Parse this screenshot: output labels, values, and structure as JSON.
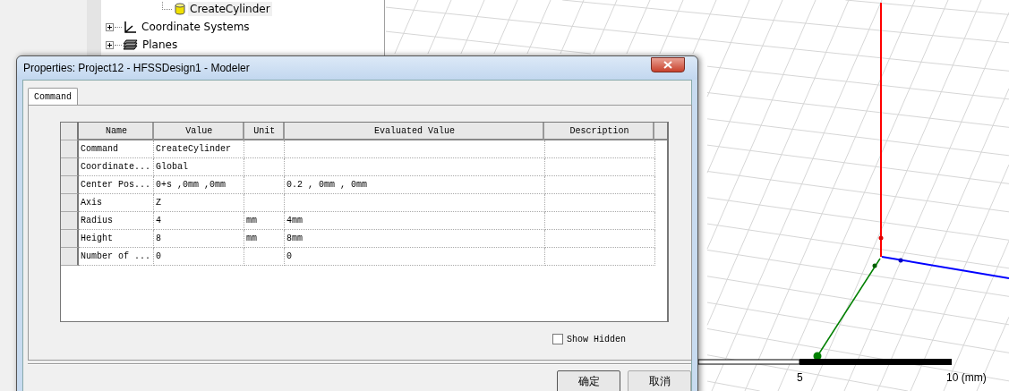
{
  "tree": {
    "items": [
      {
        "label": "CreateCylinder",
        "kind": "cylinder",
        "selected": true
      },
      {
        "label": "Coordinate Systems",
        "kind": "coordinate-systems",
        "expanded": false,
        "selected": false
      },
      {
        "label": "Planes",
        "kind": "planes",
        "expanded": false,
        "selected": false
      }
    ]
  },
  "viewport": {
    "scale_labels": [
      "5",
      "10 (mm)"
    ]
  },
  "dialog": {
    "title": "Properties: Project12 - HFSSDesign1 - Modeler",
    "tabs": [
      {
        "label": "Command",
        "selected": true
      }
    ],
    "table": {
      "columns": [
        "Name",
        "Value",
        "Unit",
        "Evaluated Value",
        "Description"
      ],
      "rows": [
        {
          "name": "Command",
          "value": "CreateCylinder"
        },
        {
          "name": "Coordinate...",
          "value": "Global"
        },
        {
          "name": "Center Pos...",
          "value": "0+s ,0mm ,0mm",
          "evaluated_value": "0.2 , 0mm , 0mm"
        },
        {
          "name": "Axis",
          "value": "Z"
        },
        {
          "name": "Radius",
          "value": "4",
          "unit": "mm",
          "evaluated_value": "4mm"
        },
        {
          "name": "Height",
          "value": "8",
          "unit": "mm",
          "evaluated_value": "8mm"
        },
        {
          "name": "Number of ...",
          "value": "0",
          "evaluated_value": "0"
        }
      ]
    },
    "show_hidden": {
      "label": "Show Hidden",
      "checked": false
    },
    "buttons": [
      "确定",
      "取消"
    ]
  }
}
